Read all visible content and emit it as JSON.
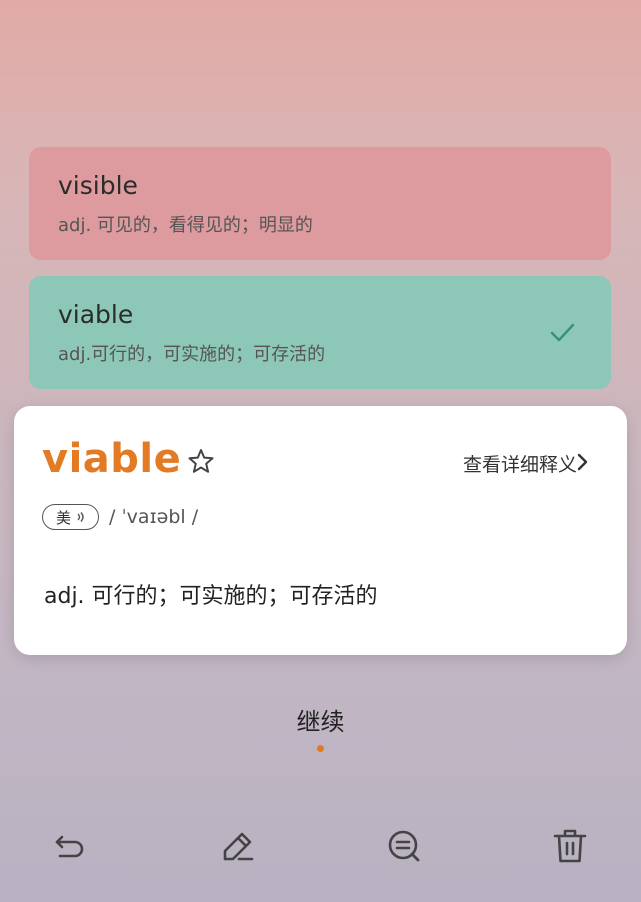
{
  "options": [
    {
      "word": "visible",
      "definition": "adj. 可见的，看得见的；明显的",
      "state": "wrong"
    },
    {
      "word": "viable",
      "definition": "adj.可行的，可实施的；可存活的",
      "state": "correct"
    }
  ],
  "detail": {
    "word": "viable",
    "more_link": "查看详细释义",
    "region": "美",
    "phonetic": "/ ˈvaɪəbl /",
    "meaning": "adj. 可行的；可实施的；可存活的"
  },
  "continue_label": "继续",
  "colors": {
    "accent": "#e37b25",
    "wrong_bg": "#dd9a9f",
    "correct_bg": "#8cc7b8",
    "check": "#3a8f7c"
  },
  "toolbar": [
    "undo-icon",
    "edit-icon",
    "search-comment-icon",
    "trash-icon"
  ]
}
